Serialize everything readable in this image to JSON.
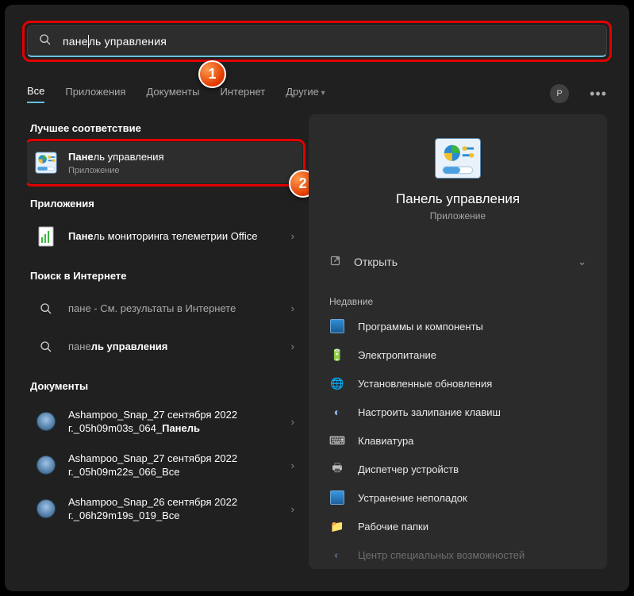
{
  "search": {
    "prefix": "пане",
    "suffix": "ль управления"
  },
  "tabs": {
    "all": "Все",
    "apps": "Приложения",
    "docs": "Документы",
    "web": "Интернет",
    "other": "Другие"
  },
  "avatar_letter": "P",
  "badges": {
    "one": "1",
    "two": "2"
  },
  "left": {
    "best_match": "Лучшее соответствие",
    "top": {
      "title_bold": "Пане",
      "title_rest": "ль управления",
      "sub": "Приложение"
    },
    "apps_head": "Приложения",
    "app1": {
      "bold": "Пане",
      "rest": "ль мониторинга телеметрии Office"
    },
    "web_head": "Поиск в Интернете",
    "web1": {
      "bold": "пане",
      "rest": " - См. результаты в Интернете"
    },
    "web2": {
      "pre": "пане",
      "bold": "ль управления"
    },
    "docs_head": "Документы",
    "doc1": {
      "line": "Ashampoo_Snap_27 сентября 2022 г._05h09m03s_064_",
      "bold": "Панель"
    },
    "doc2": "Ashampoo_Snap_27 сентября 2022 г._05h09m22s_066_Все",
    "doc3": "Ashampoo_Snap_26 сентября 2022 г._06h29m19s_019_Все"
  },
  "right": {
    "title": "Панель управления",
    "sub": "Приложение",
    "open": "Открыть",
    "recent": "Недавние",
    "items": [
      "Программы и компоненты",
      "Электропитание",
      "Установленные обновления",
      "Настроить залипание клавиш",
      "Клавиатура",
      "Диспетчер устройств",
      "Устранение неполадок",
      "Рабочие папки",
      "Центр специальных возможностей"
    ]
  }
}
